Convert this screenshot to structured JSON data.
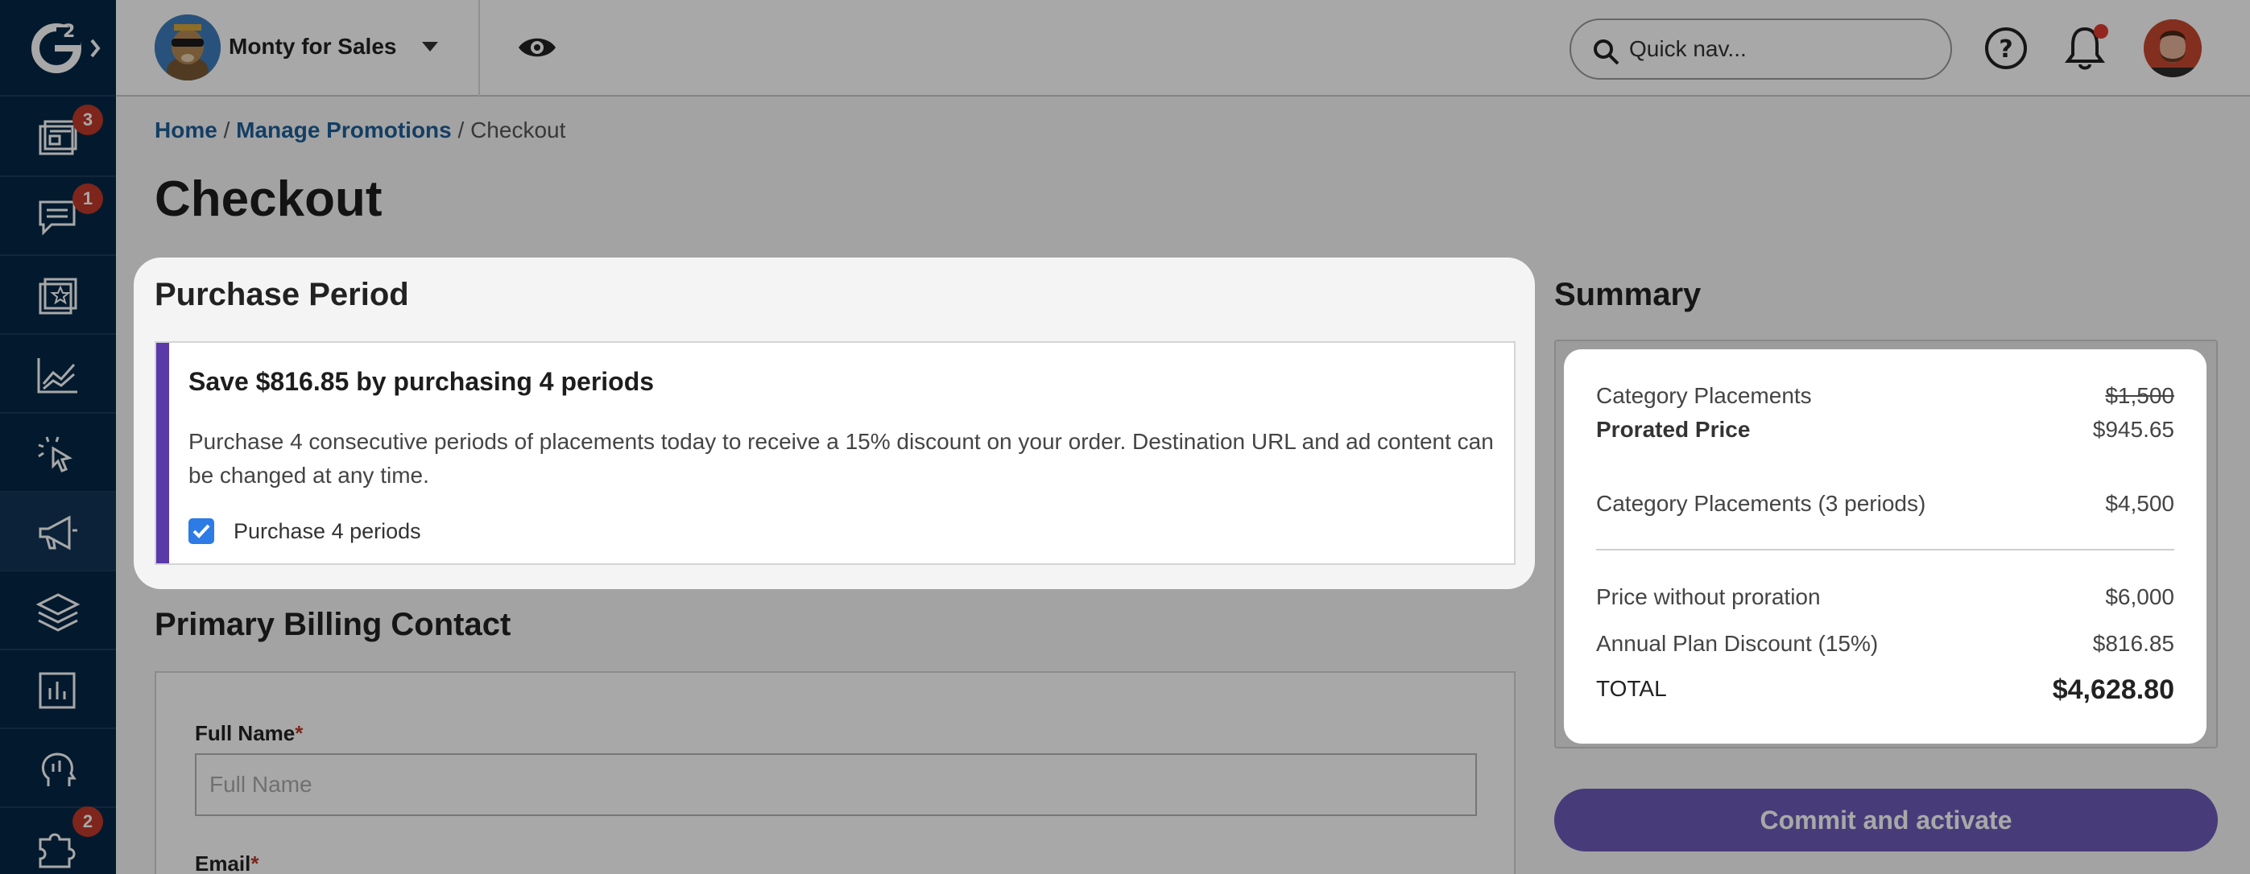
{
  "sidebar": {
    "badges": [
      "3",
      "1",
      "2"
    ]
  },
  "topbar": {
    "company": "Monty for Sales",
    "search_placeholder": "Quick nav..."
  },
  "breadcrumb": {
    "home": "Home",
    "promotions": "Manage Promotions",
    "sep": "/",
    "current": "Checkout"
  },
  "page_title": "Checkout",
  "purchase_period": {
    "title": "Purchase Period",
    "promo_title": "Save $816.85 by purchasing 4 periods",
    "promo_desc": "Purchase 4 consecutive periods of placements today to receive a 15% discount on your order. Destination URL and ad content can be changed at any time.",
    "checkbox_label": "Purchase 4 periods",
    "checked": true
  },
  "billing": {
    "title": "Primary Billing Contact",
    "full_name_label": "Full Name",
    "full_name_placeholder": "Full Name",
    "email_label": "Email",
    "required_mark": "*"
  },
  "summary": {
    "title": "Summary",
    "rows": [
      {
        "label": "Category Placements",
        "value": "$1,500"
      },
      {
        "label": "Prorated Price",
        "value": "$945.65"
      },
      {
        "label": "Category Placements (3 periods)",
        "value": "$4,500"
      },
      {
        "label": "Price without proration",
        "value": "$6,000"
      },
      {
        "label": "Annual Plan Discount (15%)",
        "value": "$816.85"
      },
      {
        "label": "TOTAL",
        "value": "$4,628.80"
      }
    ]
  },
  "commit_button": "Commit and activate",
  "colors": {
    "sidebar_bg": "#062846",
    "accent_purple": "#5a39a8",
    "link_blue": "#1d5f9a",
    "badge_red": "#c0392b",
    "commit_button": "#6c5bb8"
  }
}
